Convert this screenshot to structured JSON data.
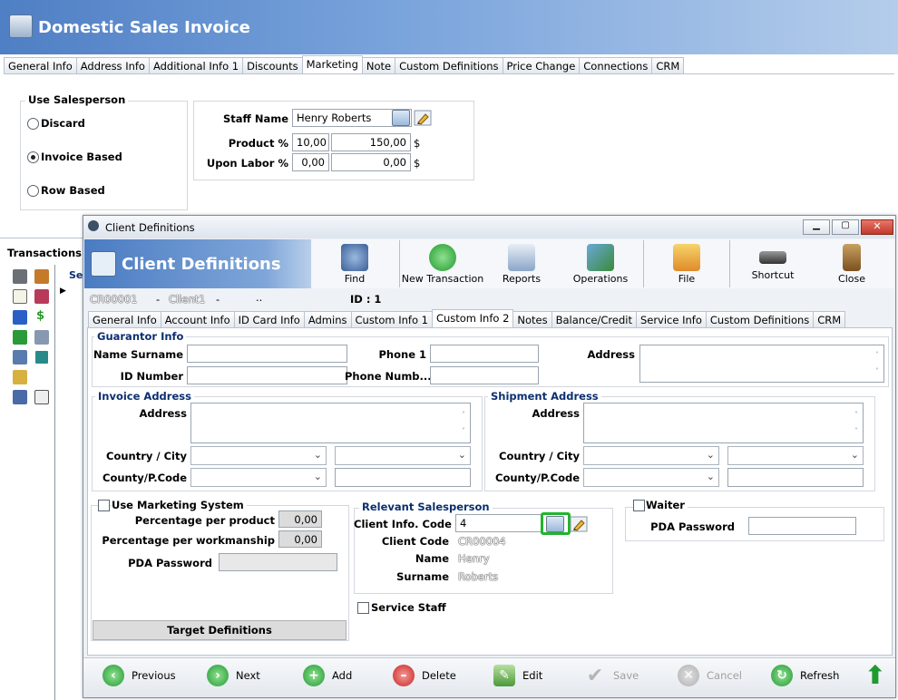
{
  "app": {
    "title": "Domestic Sales Invoice",
    "tabs": [
      "General Info",
      "Address Info",
      "Additional Info 1",
      "Discounts",
      "Marketing",
      "Note",
      "Custom Definitions",
      "Price Change",
      "Connections",
      "CRM"
    ],
    "active_tab": "Marketing"
  },
  "marketing": {
    "use_salesperson_title": "Use Salesperson",
    "options": [
      "Discard",
      "Invoice Based",
      "Row Based"
    ],
    "selected": "Invoice Based",
    "staff_name_label": "Staff Name",
    "staff_name_value": "Henry Roberts",
    "product_label": "Product %",
    "product_pct": "10,00",
    "product_amount": "150,00",
    "labor_label": "Upon Labor %",
    "labor_pct": "0,00",
    "labor_amount": "0,00",
    "currency": "$"
  },
  "left_panel": {
    "transactions_label": "Transactions",
    "tree_col": "Se"
  },
  "dialog": {
    "window_title": "Client Definitions",
    "banner_title": "Client Definitions",
    "toolbar": [
      "Find",
      "New Transaction",
      "Reports",
      "Operations",
      "File",
      "Shortcut",
      "Close"
    ],
    "record_code": "CR00001",
    "record_name": "Client1",
    "record_extra": "..",
    "record_id": "ID : 1",
    "tabs": [
      "General Info",
      "Account Info",
      "ID Card Info",
      "Admins",
      "Custom Info 1",
      "Custom Info 2",
      "Notes",
      "Balance/Credit",
      "Service Info",
      "Custom Definitions",
      "CRM"
    ],
    "active_tab": "Custom Info 2",
    "guarantor": {
      "title": "Guarantor Info",
      "name_label": "Name Surname",
      "id_label": "ID Number",
      "phone1_label": "Phone 1",
      "phone_num_label": "Phone Numb...",
      "address_label": "Address"
    },
    "invoice_address": {
      "title": "Invoice Address",
      "address_label": "Address",
      "country_label": "Country / City",
      "county_label": "County/P.Code"
    },
    "shipment_address": {
      "title": "Shipment Address",
      "address_label": "Address",
      "country_label": "Country / City",
      "county_label": "County/P.Code"
    },
    "marketing_system": {
      "label": "Use Marketing System",
      "pct_product_label": "Percentage per product",
      "pct_product_value": "0,00",
      "pct_work_label": "Percentage per workmanship",
      "pct_work_value": "0,00",
      "pda_label": "PDA Password",
      "target_button": "Target Definitions"
    },
    "relevant_salesperson": {
      "title": "Relevant Salesperson",
      "client_info_code_label": "Client Info. Code",
      "client_info_code_value": "4",
      "client_code_label": "Client Code",
      "client_code_value": "CR00004",
      "name_label": "Name",
      "name_value": "Henry",
      "surname_label": "Surname",
      "surname_value": "Roberts"
    },
    "service_staff_label": "Service Staff",
    "waiter": {
      "label": "Waiter",
      "pda_label": "PDA Password"
    },
    "bottom_buttons": [
      "Previous",
      "Next",
      "Add",
      "Delete",
      "Edit",
      "Save",
      "Cancel",
      "Refresh"
    ]
  },
  "colors": {
    "highlight": "#1fb52c",
    "title_blue": "#4f7fc4",
    "group_title": "#0b2f70"
  }
}
